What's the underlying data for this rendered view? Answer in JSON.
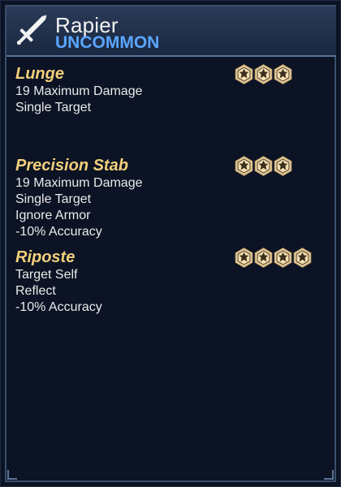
{
  "item": {
    "name": "Rapier",
    "rarity": "UNCOMMON",
    "rarity_color": "#5aa6ff",
    "icon": "sword-icon"
  },
  "abilities": [
    {
      "name": "Lunge",
      "effects": [
        "19 Maximum Damage",
        "Single Target"
      ],
      "cost": 3,
      "cost_icon": "hex-energy-icon"
    },
    {
      "name": "Precision Stab",
      "effects": [
        "19 Maximum Damage",
        "Single Target",
        "Ignore Armor",
        "-10% Accuracy"
      ],
      "cost": 3,
      "cost_icon": "hex-energy-icon"
    },
    {
      "name": "Riposte",
      "effects": [
        "Target Self",
        "Reflect",
        "-10% Accuracy"
      ],
      "cost": 4,
      "cost_icon": "hex-energy-icon"
    }
  ],
  "colors": {
    "ability_name": "#f3cf7a",
    "cost_fill": "#f4ddb0",
    "cost_outline": "#c9a970",
    "background": "#0b1324"
  }
}
